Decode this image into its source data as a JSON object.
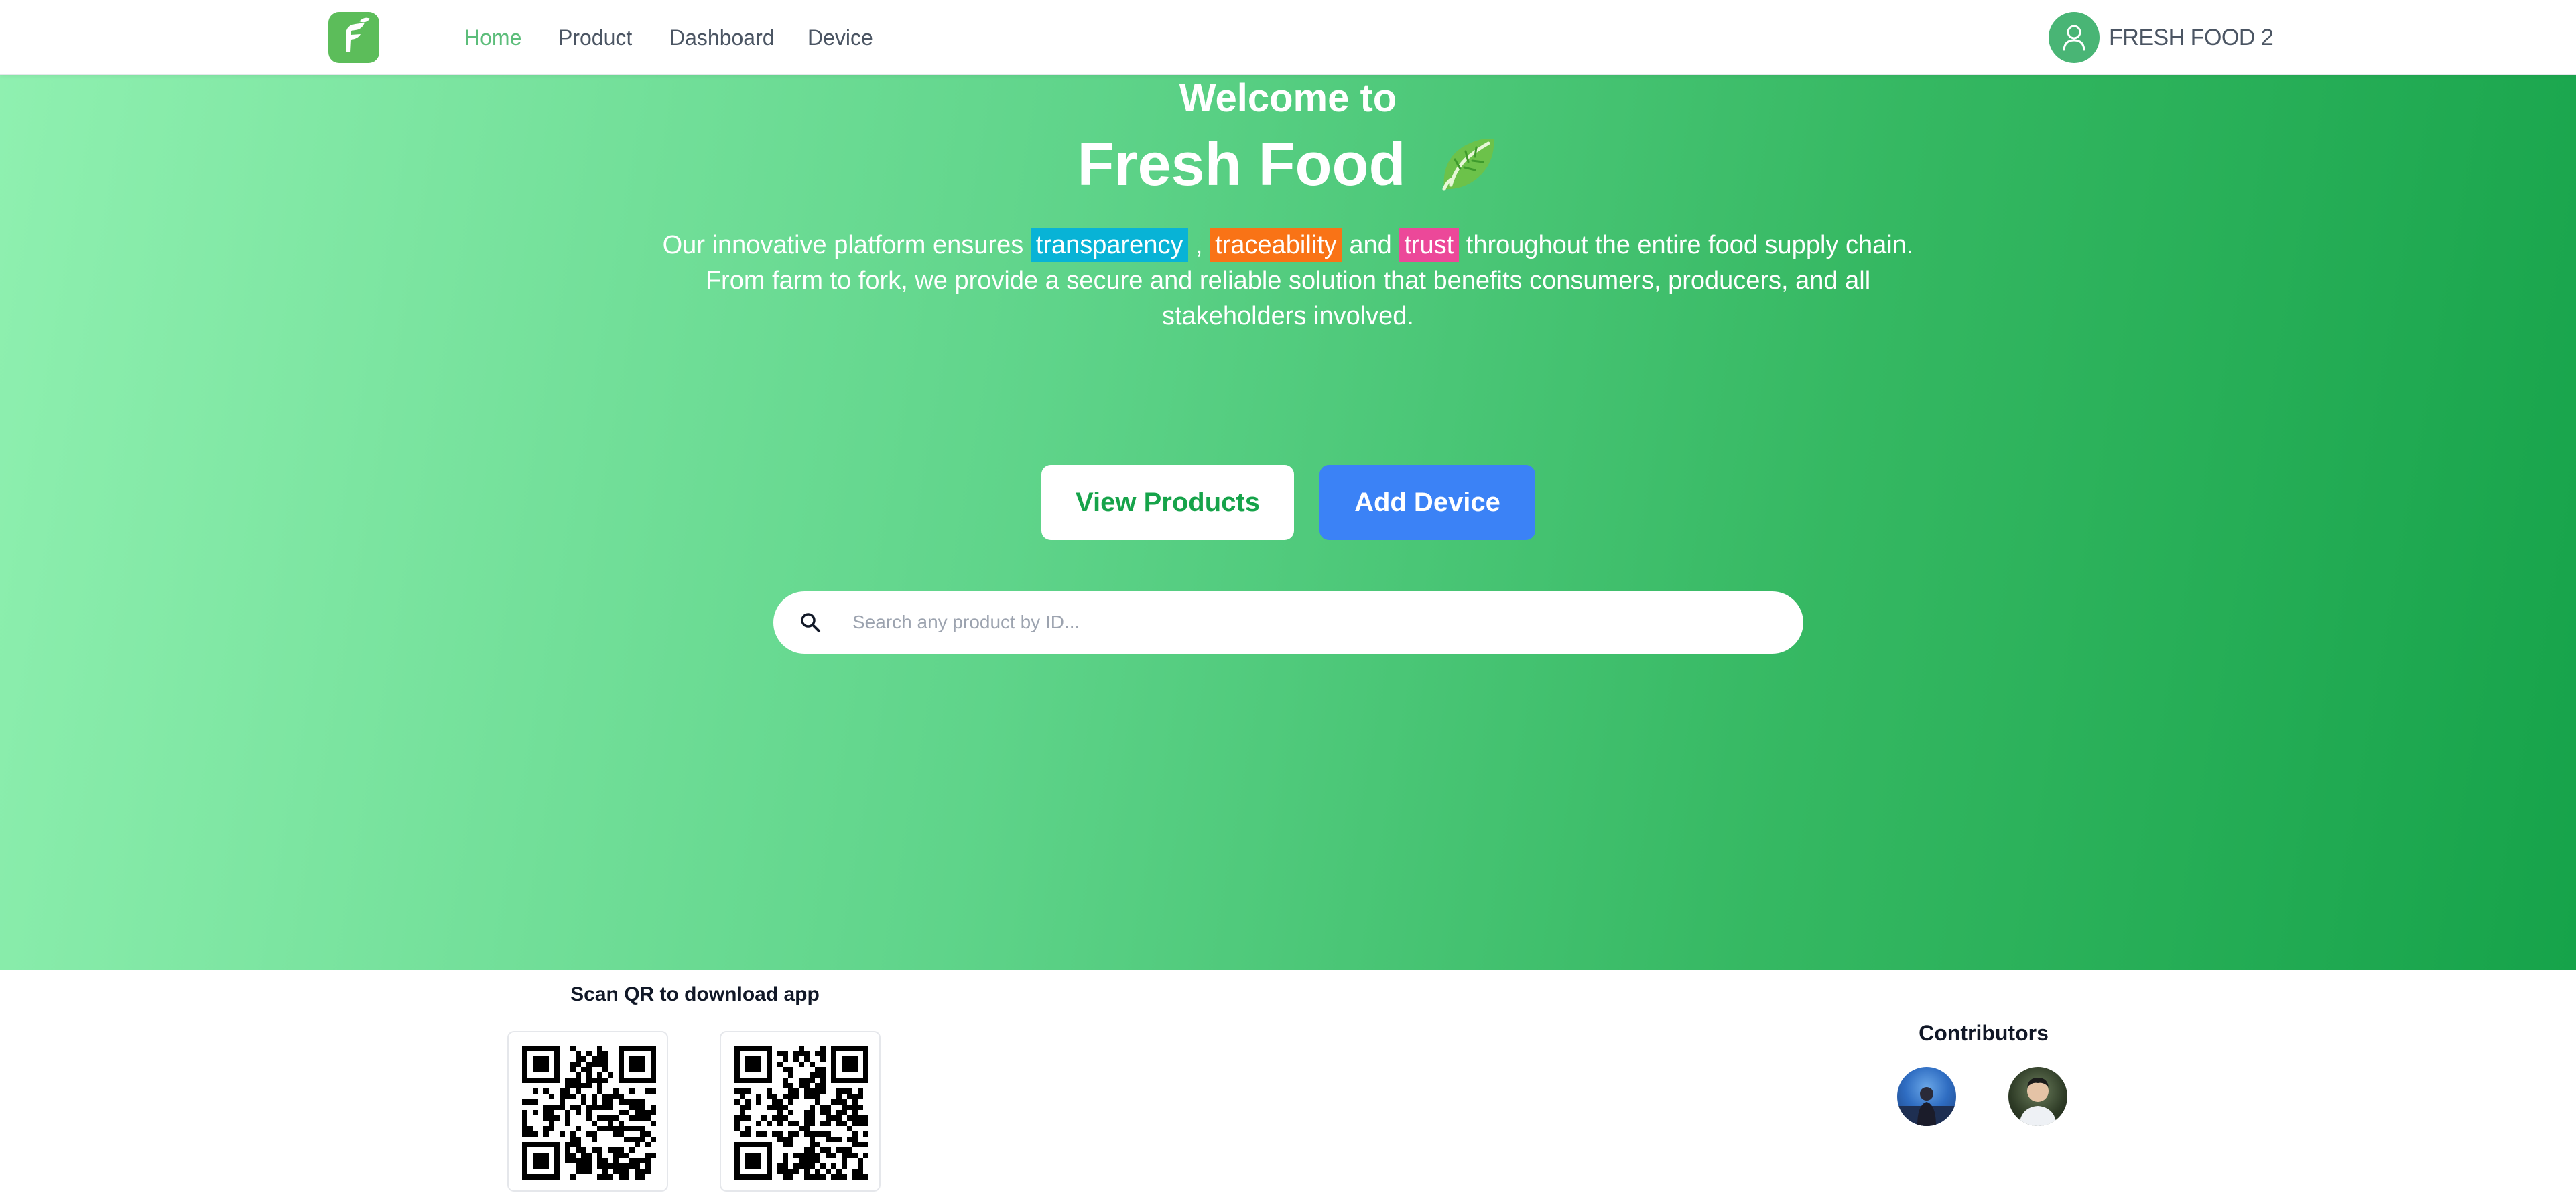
{
  "nav": {
    "links": [
      "Home",
      "Product",
      "Dashboard",
      "Device"
    ],
    "active": "Home",
    "user_name": "FRESH FOOD 2"
  },
  "hero": {
    "welcome": "Welcome to",
    "brand": "Fresh Food",
    "intro_pre": "Our innovative platform ensures ",
    "highlight_1": "transparency",
    "sep_1": " , ",
    "highlight_2": "traceability",
    "sep_2": " and ",
    "highlight_3": "trust",
    "intro_post": " throughout the entire food supply chain. From farm to fork, we provide a secure and reliable solution that benefits consumers, producers, and all stakeholders involved.",
    "view_products_label": "View Products",
    "add_device_label": "Add Device",
    "search_placeholder": "Search any product by ID..."
  },
  "footer": {
    "qr_title": "Scan QR to download app",
    "contributors_title": "Contributors"
  },
  "colors": {
    "brand_green": "#16a34a",
    "logo_green": "#5cbd5a",
    "highlight_blue": "#08b3d6",
    "highlight_orange": "#f97316",
    "highlight_pink": "#ec4899",
    "button_blue": "#3b82f6"
  },
  "icons": [
    "logo-icon",
    "user-icon",
    "leaf-icon",
    "search-icon",
    "qr-code-icon"
  ]
}
